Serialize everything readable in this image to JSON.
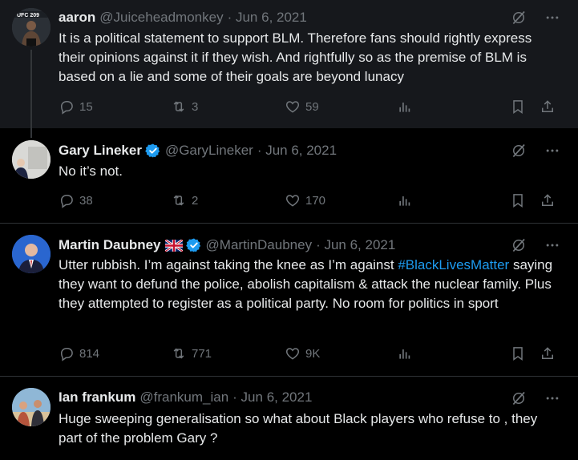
{
  "tweets": [
    {
      "name": "aaron",
      "handle": "@Juiceheadmonkey",
      "date": "· Jun 6, 2021",
      "text": "It is a political statement to support BLM. Therefore fans should rightly express their opinions against it if they wish. And rightfully so as the premise of BLM is based on a lie and some of their goals are beyond lunacy",
      "replies": "15",
      "retweets": "3",
      "likes": "59"
    },
    {
      "name": "Gary Lineker",
      "handle": "@GaryLineker",
      "date": "· Jun 6, 2021",
      "text": "No it’s not.",
      "replies": "38",
      "retweets": "2",
      "likes": "170"
    },
    {
      "name": "Martin Daubney",
      "handle": "@MartinDaubney",
      "date": "· Jun 6, 2021",
      "text_before": "Utter rubbish. I’m against taking the knee as I’m against ",
      "hashtag": "#BlackLivesMatter",
      "text_after": " saying they want to defund the police, abolish capitalism & attack the nuclear family. Plus they attempted to register as a political party. No room for politics in sport",
      "replies": "814",
      "retweets": "771",
      "likes": "9K"
    },
    {
      "name": "Ian frankum",
      "handle": "@frankum_ian",
      "date": "· Jun 6, 2021",
      "text": "Huge sweeping generalisation so what about Black players who refuse to , they part of the problem Gary ?"
    }
  ],
  "colors": {
    "background": "#000000",
    "text": "#e7e9ea",
    "muted": "#71767b",
    "accent": "#1d9bf0"
  },
  "icons": [
    "grok-icon",
    "more-icon",
    "reply-icon",
    "retweet-icon",
    "like-icon",
    "views-icon",
    "bookmark-icon",
    "share-icon",
    "verified-badge-icon",
    "uk-flag-icon"
  ]
}
